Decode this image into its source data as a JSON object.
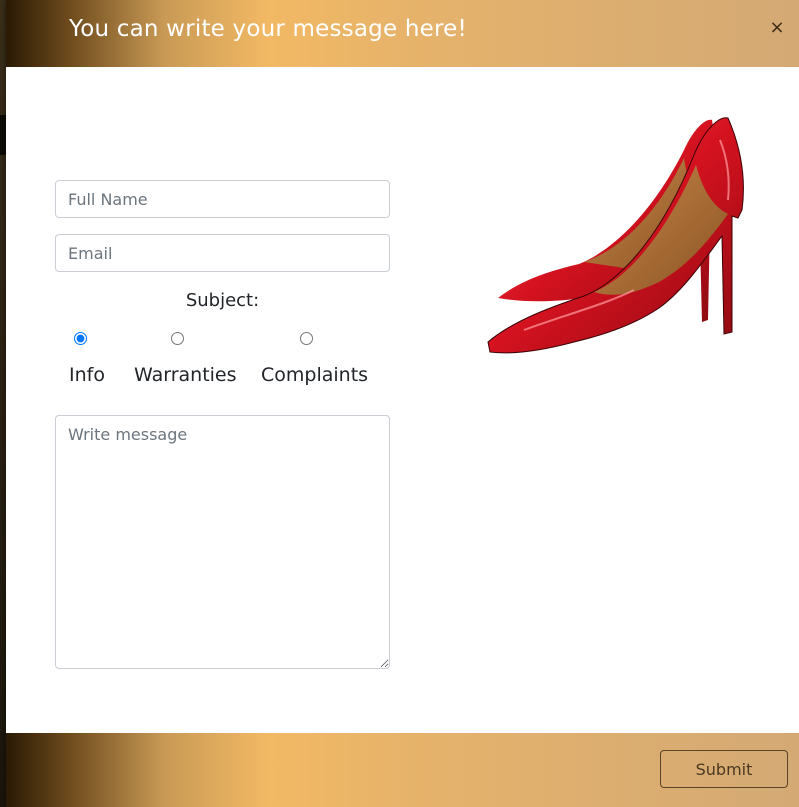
{
  "modal": {
    "title": "You can write your message here!",
    "close_label": "×"
  },
  "form": {
    "name_placeholder": "Full Name",
    "email_placeholder": "Email",
    "subject_label": "Subject:",
    "options": [
      {
        "label": "Info",
        "checked": true
      },
      {
        "label": "Warranties",
        "checked": false
      },
      {
        "label": "Complaints",
        "checked": false
      }
    ],
    "message_placeholder": "Write message"
  },
  "footer": {
    "submit_label": "Submit"
  },
  "colors": {
    "header_gradient_dark": "#2a1a05",
    "header_gradient_gold": "#f2b964",
    "shoe_red": "#d4121f"
  },
  "image": {
    "icon": "red-high-heel-shoe"
  }
}
